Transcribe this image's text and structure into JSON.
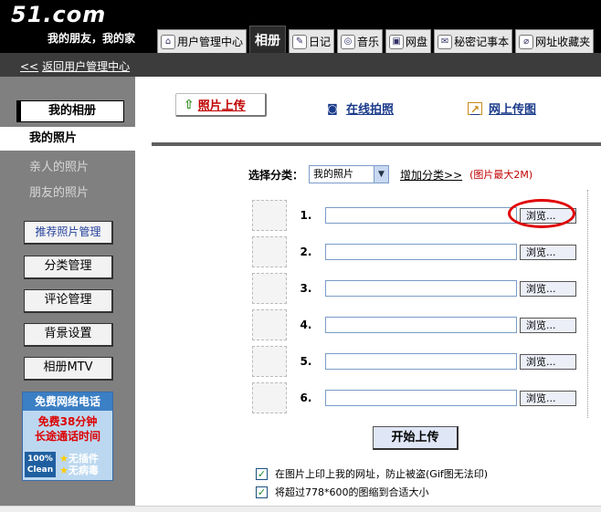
{
  "header": {
    "logo": "51.com",
    "slogan": "我的朋友，我的家",
    "tabs": [
      {
        "label": "用户管理中心",
        "icon": "house-icon"
      },
      {
        "label": "相册",
        "active": true
      },
      {
        "label": "日记",
        "icon": "notebook-icon"
      },
      {
        "label": "音乐",
        "icon": "cd-icon"
      },
      {
        "label": "网盘",
        "icon": "disk-icon"
      },
      {
        "label": "秘密记事本",
        "icon": "secret-icon"
      },
      {
        "label": "网址收藏夹",
        "icon": "paperclip-icon"
      }
    ]
  },
  "subbar": {
    "back_arrows": "<<",
    "back_link": "返回用户管理中心"
  },
  "sidebar": {
    "album_title": "我的相册",
    "nav": [
      {
        "label": "我的照片",
        "current": true
      },
      {
        "label": "亲人的照片"
      },
      {
        "label": "朋友的照片"
      }
    ],
    "buttons": [
      "推荐照片管理",
      "分类管理",
      "评论管理",
      "背景设置",
      "相册MTV"
    ],
    "ad": {
      "top": "免费网络电话",
      "line1": "免费38分钟",
      "line2": "长途通话时间",
      "badge": "100% Clean",
      "tag1": "无插件",
      "tag2": "无病毒"
    }
  },
  "main": {
    "upload_tab": "照片上传",
    "online_photo": "在线拍照",
    "web_upload": "网上传图",
    "category_label": "选择分类：",
    "category_value": "我的照片",
    "add_category": "增加分类>>",
    "size_note": "(图片最大2M)",
    "rows": [
      "1.",
      "2.",
      "3.",
      "4.",
      "5.",
      "6."
    ],
    "browse_label": "浏览...",
    "start_button": "开始上传",
    "options": [
      {
        "label": "在图片上印上我的网址，防止被盗(Gif图无法印)",
        "checked": true
      },
      {
        "label": "将超过778*600的图缩到合适大小",
        "checked": true
      }
    ]
  },
  "colors": {
    "header_bg": "#000000",
    "sidebar_bg": "#808080",
    "accent_red": "#c00000",
    "link_blue": "#1a3a8a"
  }
}
